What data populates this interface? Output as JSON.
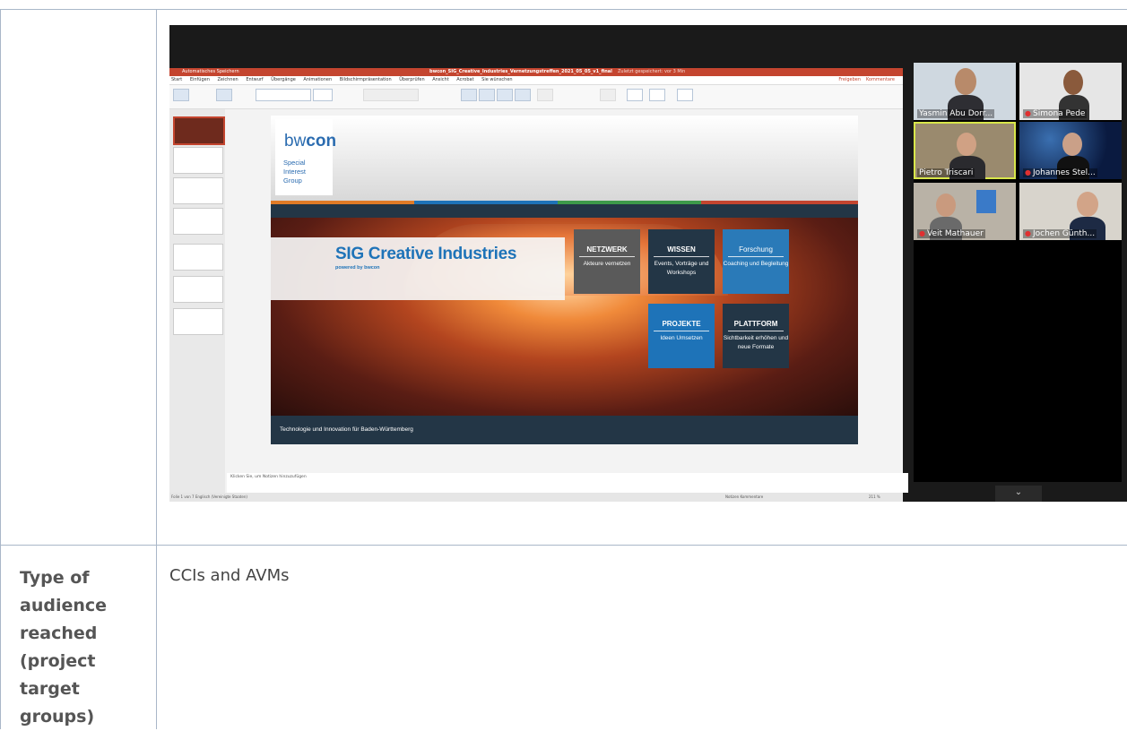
{
  "zoom": {
    "ppt": {
      "window_title": "bwcon_SIG_Creative_Industries_Vernetzungstreffen_2021_05_05_v1_final",
      "autosave_label": "Automatisches Speichern",
      "saved_status": "Zuletzt gespeichert: vor 3 Min",
      "tabs": [
        "Start",
        "Einfügen",
        "Zeichnen",
        "Entwurf",
        "Übergänge",
        "Animationen",
        "Bildschirmpräsentation",
        "Überprüfen",
        "Ansicht",
        "Acrobat",
        "Sie wünschen"
      ],
      "share_label": "Freigeben",
      "comments_label": "Kommentare",
      "notes_placeholder": "Klicken Sie, um Notizen hinzuzufügen",
      "status_left": "Folie 1 von 7   Englisch (Vereinigte Staaten)",
      "status_right": "Notizen   Kommentare",
      "zoom_level": "211 %"
    },
    "slide": {
      "logo_text_pre": "bw",
      "logo_text_bold": "con",
      "logo_sub": [
        "Special",
        "Interest",
        "Group"
      ],
      "title": "SIG Creative Industries",
      "subtitle": "powered by bwcon",
      "footer": "Technologie und Innovation für Baden-Württemberg",
      "tiles": [
        {
          "heading": "NETZWERK",
          "text": "Akteure vernetzen"
        },
        {
          "heading": "WISSEN",
          "text": "Events, Vorträge und Workshops"
        },
        {
          "heading": "Forschung",
          "text": "Coaching und Begleitung"
        },
        {
          "heading": "PROJEKTE",
          "text": "Ideen Umsetzen"
        },
        {
          "heading": "PLATTFORM",
          "text": "Sichtbarkeit erhöhen und neue Formate"
        }
      ],
      "colors": {
        "blue": "#1e73b8",
        "dark": "#233646",
        "grey_tile": "#5a5a5a",
        "stripe": [
          "#e07b27",
          "#1e73b8",
          "#3d9a4a",
          "#c4452f"
        ]
      }
    },
    "participants": [
      {
        "name": "Yasmin Abu Dorr...",
        "muted": false
      },
      {
        "name": "Simona Pede",
        "muted": true
      },
      {
        "name": "Pietro Triscari",
        "muted": false,
        "active": true
      },
      {
        "name": "Johannes Stel...",
        "muted": true
      },
      {
        "name": "Veit Mathauer",
        "muted": true
      },
      {
        "name": "Jochen Günth...",
        "muted": true
      }
    ]
  },
  "table": {
    "label_lines": [
      "Type of",
      "audience",
      "reached",
      "(project",
      "target",
      "groups)"
    ],
    "value": "CCIs and AVMs"
  }
}
